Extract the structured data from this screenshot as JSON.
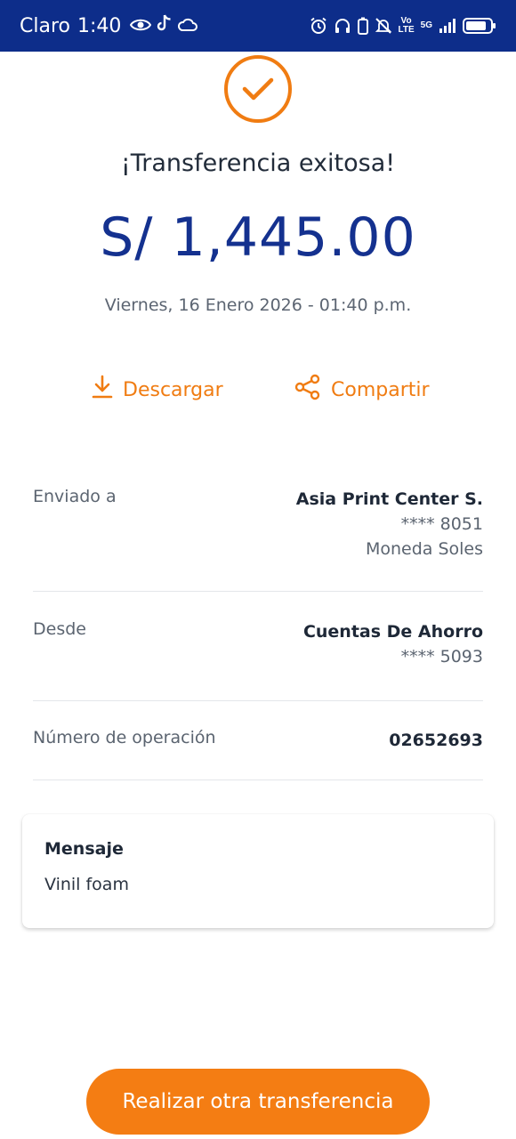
{
  "status_bar": {
    "carrier": "Claro",
    "time": "1:40",
    "network_top": "Vo",
    "network_bottom": "LTE",
    "network_gen": "5G",
    "colors": {
      "background": "#0d2d8a",
      "foreground": "#ffffff"
    },
    "icons": [
      "eye-icon",
      "tiktok-icon",
      "cloud-icon",
      "alarm-icon",
      "headphones-icon",
      "battery-saver-icon",
      "bell-off-icon",
      "signal-icon",
      "battery-icon"
    ]
  },
  "header": {
    "status_icon": "check-circle-icon",
    "title": "¡Transferencia exitosa!",
    "amount": "S/ 1,445.00",
    "date": "Viernes, 16 Enero 2026 - 01:40 p.m."
  },
  "actions": {
    "download_label": "Descargar",
    "share_label": "Compartir",
    "download_icon": "download-icon",
    "share_icon": "share-icon"
  },
  "details": {
    "recipient": {
      "label": "Enviado a",
      "name": "Asia Print Center S.",
      "account": "**** 8051",
      "currency": "Moneda Soles"
    },
    "source": {
      "label": "Desde",
      "name": "Cuentas De Ahorro",
      "account": "**** 5093"
    },
    "operation": {
      "label": "Número de operación",
      "number": "02652693"
    }
  },
  "message": {
    "title": "Mensaje",
    "text": "Vinil foam"
  },
  "cta": {
    "label": "Realizar otra transferencia"
  },
  "colors": {
    "accent": "#f47d13",
    "brand": "#14318f",
    "text": "#1e2837",
    "muted": "#5b6470"
  }
}
